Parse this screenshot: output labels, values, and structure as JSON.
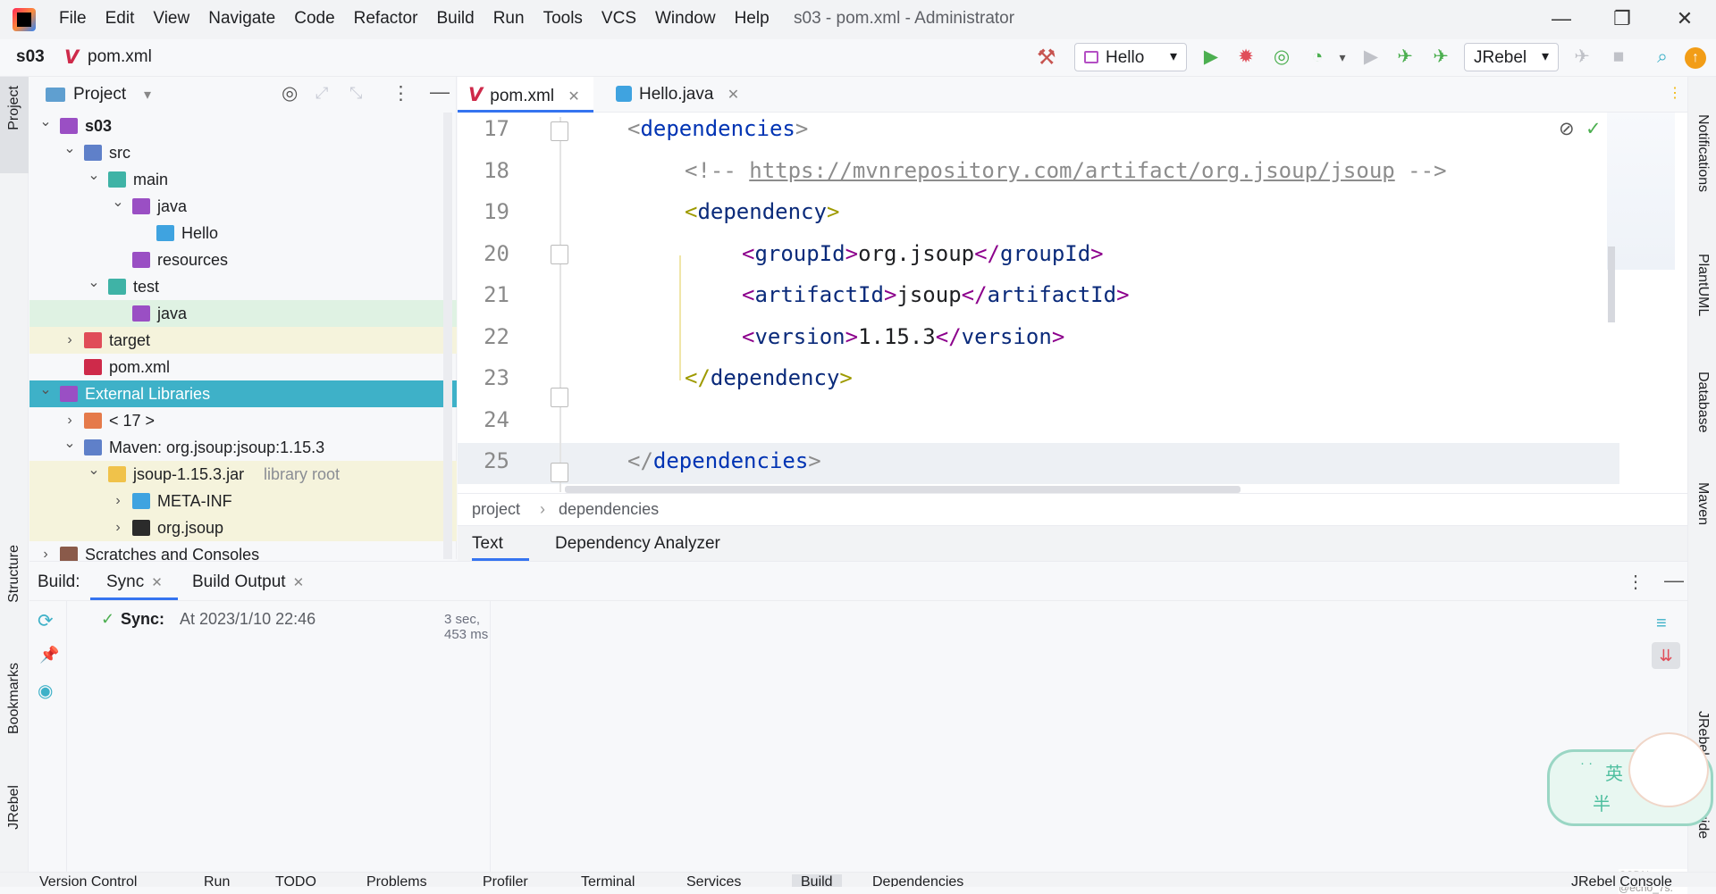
{
  "window": {
    "title": "s03 - pom.xml - Administrator",
    "menu": [
      "File",
      "Edit",
      "View",
      "Navigate",
      "Code",
      "Refactor",
      "Build",
      "Run",
      "Tools",
      "VCS",
      "Window",
      "Help"
    ],
    "minimize": "—",
    "restore": "❐",
    "close": "✕"
  },
  "navbar": {
    "project": "s03",
    "file": "pom.xml",
    "run_config": "Hello",
    "jrebel_config": "JRebel",
    "dropdown_arrow": "▾"
  },
  "left_strip": {
    "project": "Project",
    "structure": "Structure",
    "bookmarks": "Bookmarks",
    "jrebel": "JRebel"
  },
  "right_strip": {
    "notifications": "Notifications",
    "plantuml": "PlantUML",
    "database": "Database",
    "maven": "Maven",
    "jrebel_setup": "JRebel Setup Guide"
  },
  "project_panel": {
    "title": "Project",
    "tree": [
      {
        "label": "s03",
        "depth": 0,
        "expanded": true,
        "bold": true,
        "icon": "module-icon",
        "color": "#9a4fc4"
      },
      {
        "label": "src",
        "depth": 1,
        "expanded": true,
        "icon": "folder-icon",
        "color": "#5f80c9"
      },
      {
        "label": "main",
        "depth": 2,
        "expanded": true,
        "icon": "folder-icon",
        "color": "#3fb3a6"
      },
      {
        "label": "java",
        "depth": 3,
        "expanded": true,
        "icon": "source-folder-icon",
        "color": "#9a4fc4"
      },
      {
        "label": "Hello",
        "depth": 4,
        "expanded": null,
        "icon": "java-class-icon",
        "color": "#3fa3e0"
      },
      {
        "label": "resources",
        "depth": 3,
        "expanded": null,
        "icon": "resources-folder-icon",
        "color": "#9a4fc4"
      },
      {
        "label": "test",
        "depth": 2,
        "expanded": true,
        "icon": "test-folder-icon",
        "color": "#3fb3a6"
      },
      {
        "label": "java",
        "depth": 3,
        "expanded": null,
        "icon": "test-source-folder-icon",
        "color": "#9a4fc4"
      },
      {
        "label": "target",
        "depth": 1,
        "expanded": false,
        "icon": "excluded-folder-icon",
        "color": "#e04d59"
      },
      {
        "label": "pom.xml",
        "depth": 1,
        "expanded": null,
        "icon": "maven-icon",
        "color": "#ce2a4a"
      },
      {
        "label": "External Libraries",
        "depth": 0,
        "expanded": true,
        "icon": "libraries-icon",
        "color": "#9a4fc4"
      },
      {
        "label": "< 17 >",
        "depth": 1,
        "expanded": false,
        "icon": "jdk-icon",
        "color": "#e57a4a"
      },
      {
        "label": "Maven: org.jsoup:jsoup:1.15.3",
        "depth": 1,
        "expanded": true,
        "icon": "library-icon",
        "color": "#5f80c9"
      },
      {
        "label": "jsoup-1.15.3.jar",
        "suffix": "library root",
        "depth": 2,
        "expanded": true,
        "icon": "jar-icon",
        "color": "#f0c24a"
      },
      {
        "label": "META-INF",
        "depth": 3,
        "expanded": false,
        "icon": "package-icon",
        "color": "#3fa3e0"
      },
      {
        "label": "org.jsoup",
        "depth": 3,
        "expanded": false,
        "icon": "package-icon",
        "color": "#2b2b2b"
      },
      {
        "label": "Scratches and Consoles",
        "depth": 0,
        "expanded": false,
        "icon": "scratches-icon",
        "color": "#8a5a4a"
      }
    ]
  },
  "editor": {
    "tabs": [
      {
        "label": "pom.xml",
        "active": true
      },
      {
        "label": "Hello.java",
        "active": false
      }
    ],
    "lines": [
      {
        "n": "17",
        "indent": 0,
        "parts": [
          [
            "br",
            "<"
          ],
          [
            "tg",
            "dependencies"
          ],
          [
            "br",
            ">"
          ]
        ]
      },
      {
        "n": "18",
        "indent": 1,
        "parts": [
          [
            "cm",
            "<!-- "
          ],
          [
            "cmu",
            "https://mvnrepository.com/artifact/org.jsoup/jsoup"
          ],
          [
            "cm",
            " -->"
          ]
        ]
      },
      {
        "n": "19",
        "indent": 1,
        "parts": [
          [
            "br",
            "<"
          ],
          [
            "tg",
            "dependency"
          ],
          [
            "br",
            ">"
          ]
        ]
      },
      {
        "n": "20",
        "indent": 2,
        "parts": [
          [
            "br",
            "<"
          ],
          [
            "tg",
            "groupId"
          ],
          [
            "br",
            ">"
          ],
          [
            "tx",
            "org.jsoup"
          ],
          [
            "br",
            "</"
          ],
          [
            "tg",
            "groupId"
          ],
          [
            "br",
            ">"
          ]
        ]
      },
      {
        "n": "21",
        "indent": 2,
        "parts": [
          [
            "br",
            "<"
          ],
          [
            "tg",
            "artifactId"
          ],
          [
            "br",
            ">"
          ],
          [
            "tx",
            "jsoup"
          ],
          [
            "br",
            "</"
          ],
          [
            "tg",
            "artifactId"
          ],
          [
            "br",
            ">"
          ]
        ]
      },
      {
        "n": "22",
        "indent": 2,
        "parts": [
          [
            "br",
            "<"
          ],
          [
            "tg",
            "version"
          ],
          [
            "br",
            ">"
          ],
          [
            "tx",
            "1.15.3"
          ],
          [
            "br",
            "</"
          ],
          [
            "tg",
            "version"
          ],
          [
            "br",
            ">"
          ]
        ]
      },
      {
        "n": "23",
        "indent": 1,
        "parts": [
          [
            "br",
            "</"
          ],
          [
            "tg",
            "dependency"
          ],
          [
            "br",
            ">"
          ]
        ]
      },
      {
        "n": "24",
        "indent": 0,
        "parts": []
      },
      {
        "n": "25",
        "indent": 0,
        "parts": [
          [
            "br",
            "</"
          ],
          [
            "tg",
            "dependencies"
          ],
          [
            "br",
            ">"
          ]
        ]
      }
    ],
    "breadcrumb": [
      "project",
      "dependencies"
    ],
    "bottom_tabs": [
      {
        "label": "Text",
        "active": true
      },
      {
        "label": "Dependency Analyzer",
        "active": false
      }
    ]
  },
  "build_panel": {
    "label": "Build:",
    "tabs": [
      {
        "label": "Sync",
        "active": true
      },
      {
        "label": "Build Output",
        "active": false
      }
    ],
    "sync_title": "Sync:",
    "sync_text": "At 2023/1/10 22:46",
    "duration": "3 sec, 453 ms"
  },
  "mascot": {
    "badge_top": "英",
    "badge_bottom": "半",
    "dots": "· ·"
  },
  "watermark": "CSDN @echo_7s.",
  "statusbar": [
    "Version Control",
    "Run",
    "TODO",
    "Problems",
    "Profiler",
    "Terminal",
    "Services",
    "Build",
    "Dependencies"
  ],
  "statusbar_right": "JRebel Console",
  "colors": {
    "selection": "#3eb1c8",
    "test_highlight": "#dff2e3",
    "excluded_highlight": "#f5f3dc",
    "jar_highlight": "#f5f3dc"
  }
}
